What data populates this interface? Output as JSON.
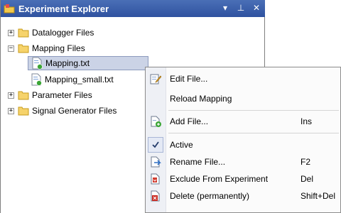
{
  "window": {
    "title": "Experiment Explorer",
    "controls": [
      "dropdown-icon",
      "pin-icon",
      "close-icon"
    ]
  },
  "tree": {
    "items": [
      {
        "label": "Datalogger Files",
        "expander": "+"
      },
      {
        "label": "Mapping Files",
        "expander": "−"
      },
      {
        "label": "Mapping.txt",
        "selected": true
      },
      {
        "label": "Mapping_small.txt"
      },
      {
        "label": "Parameter Files",
        "expander": "+"
      },
      {
        "label": "Signal Generator Files",
        "expander": "+"
      }
    ]
  },
  "context_menu": {
    "items": [
      {
        "label": "Edit File...",
        "icon": "edit-icon",
        "shortcut": ""
      },
      {
        "label": "Reload Mapping",
        "icon": "",
        "shortcut": ""
      },
      {
        "label": "Add File...",
        "icon": "add-file-icon",
        "shortcut": "Ins"
      },
      {
        "label": "Active",
        "icon": "check-icon",
        "shortcut": "",
        "checked": true
      },
      {
        "label": "Rename File...",
        "icon": "rename-icon",
        "shortcut": "F2"
      },
      {
        "label": "Exclude From Experiment",
        "icon": "exclude-icon",
        "shortcut": "Del"
      },
      {
        "label": "Delete (permanently)",
        "icon": "delete-icon",
        "shortcut": "Shift+Del"
      }
    ]
  },
  "colors": {
    "titlebar": "#2f52a0",
    "selection": "#cbd3e6",
    "folder": "#f2c94c"
  }
}
